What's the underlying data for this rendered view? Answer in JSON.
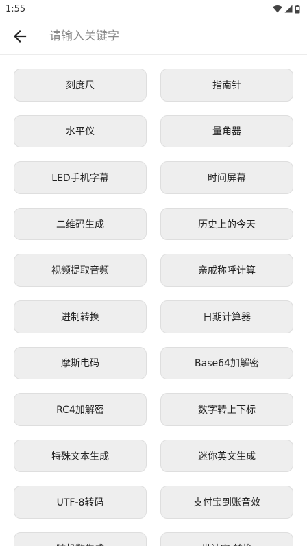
{
  "status_bar": {
    "time": "1:55",
    "icons": [
      "wifi-icon",
      "cellular-signal-icon",
      "battery-icon"
    ]
  },
  "search": {
    "placeholder": "请输入关键字",
    "value": ""
  },
  "tools": [
    "刻度尺",
    "指南针",
    "水平仪",
    "量角器",
    "LED手机字幕",
    "时间屏幕",
    "二维码生成",
    "历史上的今天",
    "视频提取音频",
    "亲戚称呼计算",
    "进制转换",
    "日期计算器",
    "摩斯电码",
    "Base64加解密",
    "RC4加解密",
    "数字转上下标",
    "特殊文本生成",
    "迷你英文生成",
    "UTF-8转码",
    "支付宝到账音效",
    "随机数生成",
    "世计宝 转换"
  ],
  "colors": {
    "button_bg": "#eeeeee",
    "button_border": "#dedede",
    "text": "#222222",
    "placeholder": "#8a8a8a"
  }
}
